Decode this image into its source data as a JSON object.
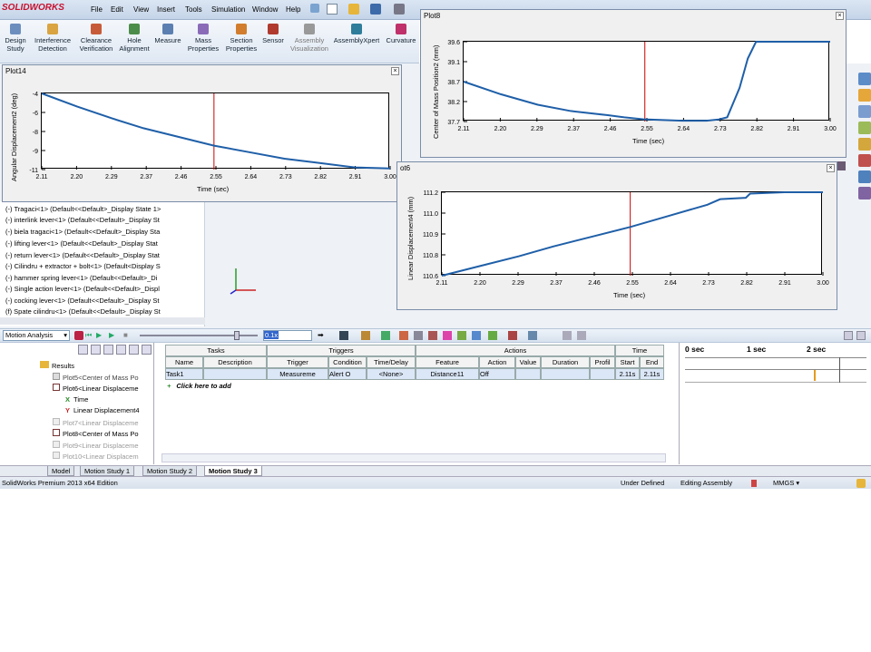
{
  "app": {
    "brand": "SOLIDWORKS",
    "menus": [
      "File",
      "Edit",
      "View",
      "Insert",
      "Tools",
      "Simulation",
      "Window",
      "Help"
    ]
  },
  "toolbar": {
    "items": [
      {
        "label": "Design\nStudy",
        "icon": "design-study-icon",
        "color": "#6c8ebf"
      },
      {
        "label": "Interference\nDetection",
        "icon": "interference-icon",
        "color": "#d9a441"
      },
      {
        "label": "Clearance\nVerification",
        "icon": "clearance-icon",
        "color": "#c75b39"
      },
      {
        "label": "Hole\nAlignment",
        "icon": "hole-icon",
        "color": "#4c8c4a"
      },
      {
        "label": "Measure",
        "icon": "measure-icon",
        "color": "#5b7fb1"
      },
      {
        "label": "Mass\nProperties",
        "icon": "mass-icon",
        "color": "#8a6bb8"
      },
      {
        "label": "Section\nProperties",
        "icon": "section-icon",
        "color": "#d27d2d"
      },
      {
        "label": "Sensor",
        "icon": "sensor-icon",
        "color": "#b03a2e"
      },
      {
        "label": "Assembly\nVisualization",
        "icon": "assembly-vis-icon",
        "color": "#999999"
      },
      {
        "label": "AssemblyXpert",
        "icon": "assemblyxpert-icon",
        "color": "#2e7d9a"
      },
      {
        "label": "Curvature",
        "icon": "curvature-icon",
        "color": "#c0306a"
      }
    ]
  },
  "plots": {
    "plot14": {
      "title": "Plot14",
      "ylabel": "Angular Displacement2 (deg)",
      "xlabel": "Time (sec)"
    },
    "plot8": {
      "title": "Plot8",
      "ylabel": "Center of Mass Position2 (mm)",
      "xlabel": "Time (sec)"
    },
    "plot6": {
      "title": "ot6",
      "ylabel": "Linear Displacement4 (mm)",
      "xlabel": "Time (sec)"
    }
  },
  "chart_data": [
    {
      "type": "line",
      "title": "Plot14",
      "xlabel": "Time (sec)",
      "ylabel": "Angular Displacement2 (deg)",
      "xlim": [
        2.11,
        3.0
      ],
      "ylim": [
        -11,
        -4
      ],
      "xticks": [
        "2.11",
        "2.20",
        "2.29",
        "2.37",
        "2.46",
        "2.55",
        "2.64",
        "2.73",
        "2.82",
        "2.91",
        "3.00"
      ],
      "yticks": [
        "-4",
        "-6",
        "-8",
        "-9",
        "-11"
      ],
      "series": [
        {
          "x": [
            2.11,
            2.2,
            2.29,
            2.37,
            2.46,
            2.55,
            2.64,
            2.73,
            2.82,
            2.91,
            3.0
          ],
          "y": [
            -4.0,
            -5.2,
            -6.3,
            -7.2,
            -8.0,
            -8.8,
            -9.4,
            -10.0,
            -10.4,
            -10.8,
            -10.9
          ]
        }
      ],
      "marker_x": 2.55
    },
    {
      "type": "line",
      "title": "Plot8",
      "xlabel": "Time (sec)",
      "ylabel": "Center of Mass Position2 (mm)",
      "xlim": [
        2.11,
        3.0
      ],
      "ylim": [
        37.7,
        39.6
      ],
      "xticks": [
        "2.11",
        "2.20",
        "2.29",
        "2.37",
        "2.46",
        "2.55",
        "2.64",
        "2.73",
        "2.82",
        "2.91",
        "3.00"
      ],
      "yticks": [
        "39.6",
        "39.1",
        "38.7",
        "38.2",
        "37.7"
      ],
      "series": [
        {
          "x": [
            2.11,
            2.2,
            2.29,
            2.37,
            2.46,
            2.5,
            2.55,
            2.64,
            2.7,
            2.73,
            2.75,
            2.78,
            2.8,
            2.82,
            2.91,
            3.0
          ],
          "y": [
            38.65,
            38.35,
            38.1,
            37.95,
            37.85,
            37.8,
            37.75,
            37.72,
            37.72,
            37.75,
            37.8,
            38.5,
            39.2,
            39.6,
            39.6,
            39.6
          ]
        }
      ],
      "marker_x": 2.55
    },
    {
      "type": "line",
      "title": "ot6",
      "xlabel": "Time (sec)",
      "ylabel": "Linear Displacement4 (mm)",
      "xlim": [
        2.11,
        3.0
      ],
      "ylim": [
        110.6,
        111.2
      ],
      "xticks": [
        "2.11",
        "2.20",
        "2.29",
        "2.37",
        "2.46",
        "2.55",
        "2.64",
        "2.73",
        "2.82",
        "2.91",
        "3.00"
      ],
      "yticks": [
        "111.2",
        "111.0",
        "110.9",
        "110.8",
        "110.6"
      ],
      "series": [
        {
          "x": [
            2.11,
            2.2,
            2.29,
            2.37,
            2.46,
            2.55,
            2.64,
            2.73,
            2.76,
            2.82,
            2.83,
            2.91,
            3.0
          ],
          "y": [
            110.6,
            110.67,
            110.74,
            110.81,
            110.88,
            110.95,
            111.03,
            111.11,
            111.15,
            111.16,
            111.19,
            111.2,
            111.2
          ]
        }
      ],
      "marker_x": 2.55
    }
  ],
  "feature_tree": {
    "items": [
      "(-) Tragaci<1> (Default<<Default>_Display State 1>",
      "(-) interlink lever<1> (Default<<Default>_Display St",
      "(-) biela tragaci<1> (Default<<Default>_Display Sta",
      "(-) lifting lever<1> (Default<<Default>_Display Stat",
      "(-) return lever<1> (Default<<Default>_Display Stat",
      "(-) Cilindru + extractor + bolt<1> (Default<Display S",
      "(-) hammer spring lever<1> (Default<<Default>_Di",
      "(-) Single action lever<1> (Default<<Default>_Displ",
      "(-) cocking lever<1> (Default<<Default>_Display St",
      "(f) Spate cilindru<1> (Default<<Default>_Display St"
    ]
  },
  "motion": {
    "study_type": "Motion Analysis",
    "zoom": "0.1x",
    "results_tree": [
      {
        "label": "Results",
        "level": 0
      },
      {
        "label": "Plot5<Center of Mass Po",
        "level": 1
      },
      {
        "label": "Plot6<Linear Displaceme",
        "level": 1
      },
      {
        "label": "Time",
        "level": 2,
        "glyph": "X"
      },
      {
        "label": "Linear Displacement4",
        "level": 2,
        "glyph": "Y"
      },
      {
        "label": "Plot7<Linear Displaceme",
        "level": 1
      },
      {
        "label": "Plot8<Center of Mass Po",
        "level": 1
      },
      {
        "label": "Plot9<Linear Displaceme",
        "level": 1
      },
      {
        "label": "Plot10<Linear Displacem",
        "level": 1
      }
    ],
    "groups": {
      "tasks": "Tasks",
      "triggers": "Triggers",
      "actions": "Actions",
      "time": "Time"
    },
    "columns": [
      "Name",
      "Description",
      "Trigger",
      "Condition",
      "Time/Delay",
      "Feature",
      "Action",
      "Value",
      "Duration",
      "Profil",
      "Start",
      "End"
    ],
    "row": [
      "Task1",
      "",
      "Measureme",
      "Alert O",
      "<None>",
      "Distance11",
      "Off",
      "",
      "",
      "",
      "2.11s",
      "2.11s"
    ],
    "add_row": "Click here to add",
    "timeline": [
      "0 sec",
      "1 sec",
      "2 sec"
    ]
  },
  "tabs": [
    "Model",
    "Motion Study 1",
    "Motion Study 2",
    "Motion Study 3"
  ],
  "status": {
    "edition": "SolidWorks Premium 2013 x64 Edition",
    "state": "Under Defined",
    "mode": "Editing Assembly",
    "units": "MMGS"
  }
}
